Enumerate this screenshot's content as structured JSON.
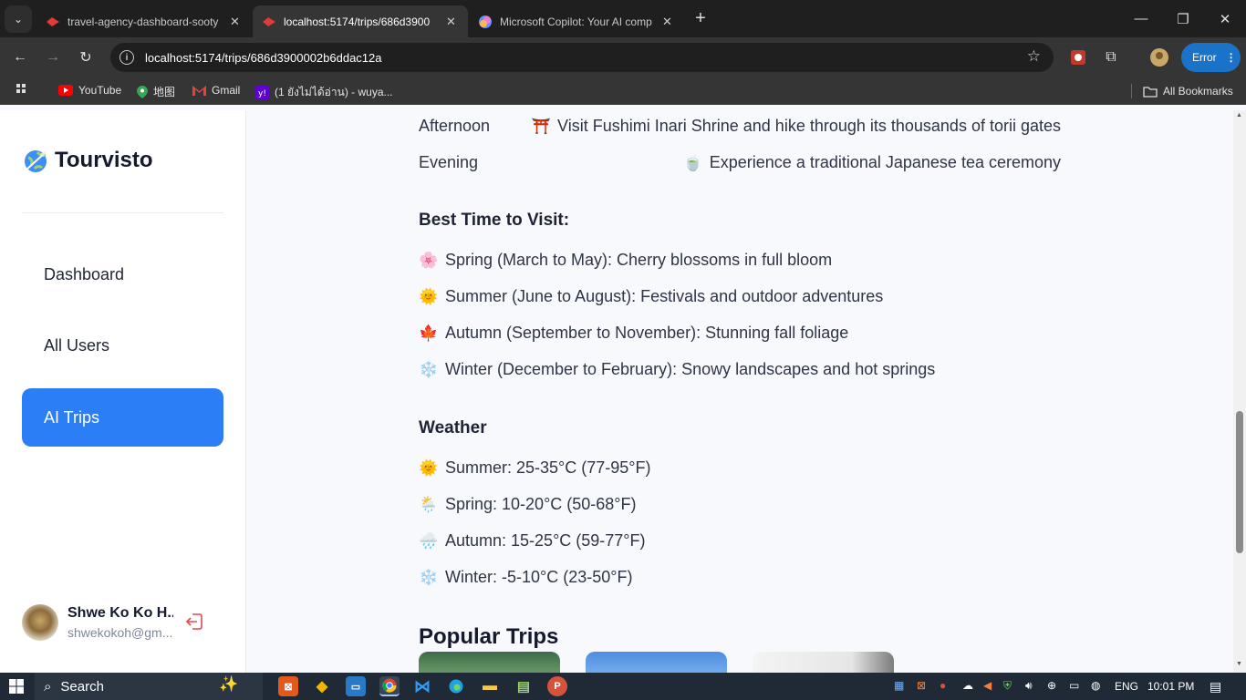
{
  "browser": {
    "tabs": [
      {
        "title": "travel-agency-dashboard-sooty",
        "active": false
      },
      {
        "title": "localhost:5174/trips/686d3900",
        "active": true
      },
      {
        "title": "Microsoft Copilot: Your AI comp",
        "active": false
      }
    ],
    "url": "localhost:5174/trips/686d3900002b6ddac12a",
    "error_label": "Error",
    "bookmarks": [
      "YouTube",
      "地图",
      "Gmail",
      "(1 ยังไม่ได้อ่าน) - wuya..."
    ],
    "all_bookmarks_label": "All Bookmarks"
  },
  "sidebar": {
    "brand": "Tourvisto",
    "nav": [
      {
        "label": "Dashboard",
        "active": false
      },
      {
        "label": "All Users",
        "active": false
      },
      {
        "label": "AI Trips",
        "active": true
      }
    ],
    "user": {
      "name": "Shwe Ko Ko H...",
      "email": "shwekokoh@gm..."
    }
  },
  "content": {
    "schedule": [
      {
        "time": "Afternoon",
        "emoji": "⛩️",
        "text": "Visit Fushimi Inari Shrine and hike through its thousands of torii gates"
      },
      {
        "time": "Evening",
        "emoji": "🍵",
        "text": "Experience a traditional Japanese tea ceremony"
      }
    ],
    "best_time_heading": "Best Time to Visit:",
    "best_time": [
      {
        "emoji": "🌸",
        "text": "Spring (March to May): Cherry blossoms in full bloom"
      },
      {
        "emoji": "🌞",
        "text": "Summer (June to August): Festivals and outdoor adventures"
      },
      {
        "emoji": "🍁",
        "text": "Autumn (September to November): Stunning fall foliage"
      },
      {
        "emoji": "❄️",
        "text": "Winter (December to February): Snowy landscapes and hot springs"
      }
    ],
    "weather_heading": "Weather",
    "weather": [
      {
        "emoji": "🌞",
        "text": "Summer: 25-35°C (77-95°F)"
      },
      {
        "emoji": "🌦️",
        "text": "Spring: 10-20°C (50-68°F)"
      },
      {
        "emoji": "🌧️",
        "text": "Autumn: 15-25°C (59-77°F)"
      },
      {
        "emoji": "❄️",
        "text": "Winter: -5-10°C (23-50°F)"
      }
    ],
    "popular_heading": "Popular Trips"
  },
  "taskbar": {
    "search_label": "Search",
    "lang": "ENG",
    "time": "10:01 PM"
  },
  "colors": {
    "accent": "#2b7ef5",
    "chrome_dark": "#1f1f1f",
    "taskbar": "#1f2a36"
  }
}
